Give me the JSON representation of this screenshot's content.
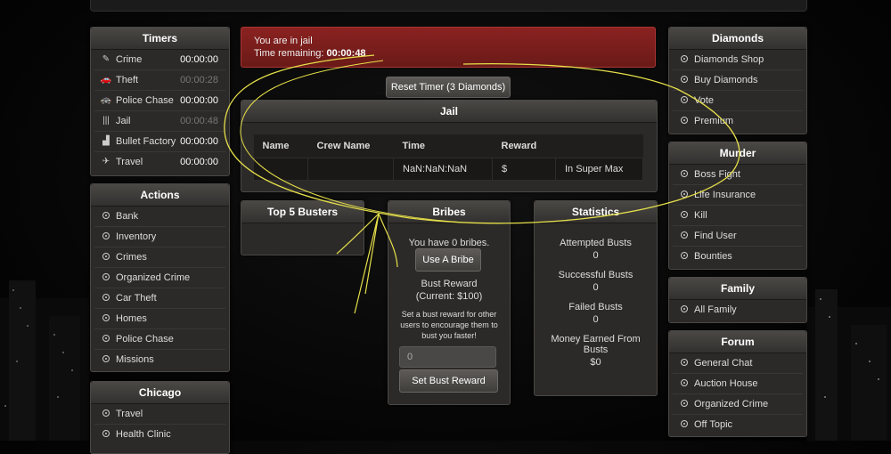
{
  "timers": {
    "title": "Timers",
    "items": [
      {
        "label": "Crime",
        "value": "00:00:00",
        "dim": false,
        "icon": "knife-icon"
      },
      {
        "label": "Theft",
        "value": "00:00:28",
        "dim": true,
        "icon": "car-icon"
      },
      {
        "label": "Police Chase",
        "value": "00:00:00",
        "dim": false,
        "icon": "police-car-icon"
      },
      {
        "label": "Jail",
        "value": "00:00:48",
        "dim": true,
        "icon": "bars-icon"
      },
      {
        "label": "Bullet Factory",
        "value": "00:00:00",
        "dim": false,
        "icon": "factory-icon"
      },
      {
        "label": "Travel",
        "value": "00:00:00",
        "dim": false,
        "icon": "plane-icon"
      }
    ]
  },
  "actions": {
    "title": "Actions",
    "items": [
      "Bank",
      "Inventory",
      "Crimes",
      "Organized Crime",
      "Car Theft",
      "Homes",
      "Police Chase",
      "Missions"
    ]
  },
  "chicago": {
    "title": "Chicago",
    "items": [
      "Travel",
      "Health Clinic"
    ]
  },
  "alert": {
    "line1": "You are in jail",
    "remaining_label": "Time remaining:",
    "remaining_value": "00:00:48"
  },
  "reset_button": "Reset Timer (3 Diamonds)",
  "jail": {
    "title": "Jail",
    "columns": [
      "Name",
      "Crew Name",
      "Time",
      "Reward",
      ""
    ],
    "row": {
      "name": "",
      "crew": "",
      "time": "NaN:NaN:NaN",
      "reward": "$",
      "status": "In Super Max"
    }
  },
  "top_busters": {
    "title": "Top 5 Busters"
  },
  "bribes": {
    "title": "Bribes",
    "count_text": "You have 0 bribes.",
    "use_button": "Use A Bribe",
    "bust_reward_label": "Bust Reward",
    "bust_reward_current": "(Current: $100)",
    "help_text": "Set a bust reward for other users to encourage them to bust you faster!",
    "input_placeholder": "0",
    "set_button": "Set Bust Reward"
  },
  "statistics": {
    "title": "Statistics",
    "items": [
      {
        "label": "Attempted Busts",
        "value": "0"
      },
      {
        "label": "Successful Busts",
        "value": "0"
      },
      {
        "label": "Failed Busts",
        "value": "0"
      },
      {
        "label": "Money Earned From Busts",
        "value": "$0"
      }
    ]
  },
  "diamonds": {
    "title": "Diamonds",
    "items": [
      "Diamonds Shop",
      "Buy Diamonds",
      "Vote",
      "Premium"
    ]
  },
  "murder": {
    "title": "Murder",
    "items": [
      "Boss Fight",
      "Life Insurance",
      "Kill",
      "Find User",
      "Bounties"
    ]
  },
  "family": {
    "title": "Family",
    "items": [
      "All Family"
    ]
  },
  "forum": {
    "title": "Forum",
    "items": [
      "General Chat",
      "Auction House",
      "Organized Crime",
      "Off Topic"
    ]
  },
  "colors": {
    "alert_bg": "#7a1e1c",
    "status_red": "#d9452f",
    "annotation": "#e6e04a"
  }
}
